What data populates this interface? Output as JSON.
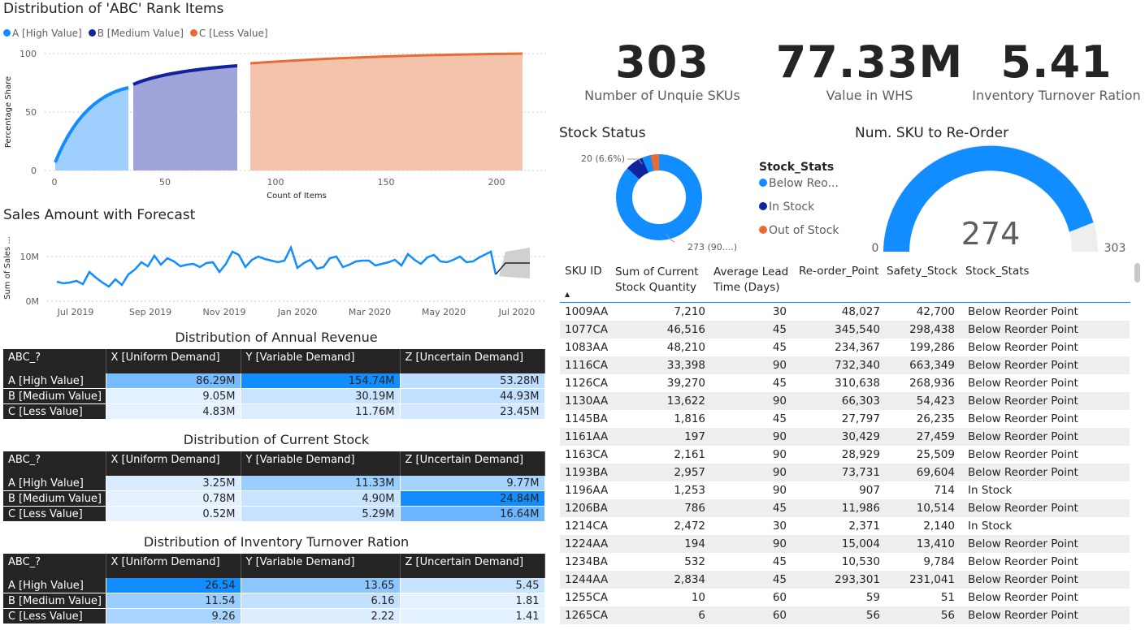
{
  "abc_chart": {
    "title": "Distribution of 'ABC' Rank Items",
    "legend": [
      {
        "label": "A [High Value]",
        "color": "#118DFF"
      },
      {
        "label": "B [Medium Value]",
        "color": "#12239E"
      },
      {
        "label": "C [Less Value]",
        "color": "#E66C37"
      }
    ],
    "ylabel": "Percentage Share",
    "xlabel": "Count of Items",
    "yticks": [
      "100",
      "50",
      "0"
    ],
    "xticks": [
      "0",
      "50",
      "100",
      "150",
      "200"
    ]
  },
  "sales_chart": {
    "title": "Sales Amount with Forecast",
    "ylabel": "Sum of Sales ...",
    "yticks": [
      "10M",
      "0M"
    ],
    "xticks": [
      "Jul 2019",
      "Sep 2019",
      "Nov 2019",
      "Jan 2020",
      "Mar 2020",
      "May 2020",
      "Jul 2020"
    ]
  },
  "kpis": [
    {
      "value": "303",
      "label": "Number of Unquie SKUs"
    },
    {
      "value": "77.33M",
      "label": "Value in WHS"
    },
    {
      "value": "5.41",
      "label": "Inventory Turnover Ration"
    }
  ],
  "stock_status": {
    "title": "Stock Status",
    "label_small": "20 (6.6%)",
    "label_large": "273 (90....)",
    "legend_title": "Stock_Stats",
    "legend": [
      {
        "label": "Below Reo...",
        "color": "#118DFF"
      },
      {
        "label": "In Stock",
        "color": "#12239E"
      },
      {
        "label": "Out of Stock",
        "color": "#E66C37"
      }
    ]
  },
  "gauge": {
    "title": "Num. SKU to Re-Order",
    "value": "274",
    "min": "0",
    "max": "303"
  },
  "matrices": [
    {
      "title": "Distribution of Annual Revenue",
      "headers": [
        "ABC_?",
        "X [Uniform Demand]",
        "Y [Variable Demand]",
        "Z [Uncertain Demand]"
      ],
      "rows": [
        {
          "label": "A [High Value]",
          "values": [
            "86.29M",
            "154.74M",
            "53.28M"
          ]
        },
        {
          "label": "B [Medium Value]",
          "values": [
            "9.05M",
            "30.19M",
            "44.93M"
          ]
        },
        {
          "label": "C [Less Value]",
          "values": [
            "4.83M",
            "11.76M",
            "23.45M"
          ]
        }
      ]
    },
    {
      "title": "Distribution of Current Stock",
      "headers": [
        "ABC_?",
        "X [Uniform Demand]",
        "Y [Variable Demand]",
        "Z [Uncertain Demand]"
      ],
      "rows": [
        {
          "label": "A [High Value]",
          "values": [
            "3.25M",
            "11.33M",
            "9.77M"
          ]
        },
        {
          "label": "B [Medium Value]",
          "values": [
            "0.78M",
            "4.90M",
            "24.84M"
          ]
        },
        {
          "label": "C [Less Value]",
          "values": [
            "0.52M",
            "5.29M",
            "16.64M"
          ]
        }
      ]
    },
    {
      "title": "Distribution of Inventory Turnover Ration",
      "headers": [
        "ABC_?",
        "X [Uniform Demand]",
        "Y [Variable Demand]",
        "Z [Uncertain Demand]"
      ],
      "rows": [
        {
          "label": "A [High Value]",
          "values": [
            "26.54",
            "13.65",
            "5.45"
          ]
        },
        {
          "label": "B [Medium Value]",
          "values": [
            "11.54",
            "6.16",
            "1.81"
          ]
        },
        {
          "label": "C [Less Value]",
          "values": [
            "9.26",
            "2.22",
            "1.41"
          ]
        }
      ]
    }
  ],
  "sku_table": {
    "headers": [
      "SKU ID",
      "Sum of Current Stock Quantity",
      "Average Lead Time (Days)",
      "Re-order_Point",
      "Safety_Stock",
      "Stock_Stats"
    ],
    "rows": [
      [
        "1009AA",
        "7,210",
        "30",
        "48,027",
        "42,700",
        "Below Reorder Point"
      ],
      [
        "1077CA",
        "46,516",
        "45",
        "345,540",
        "298,438",
        "Below Reorder Point"
      ],
      [
        "1083AA",
        "48,210",
        "45",
        "234,367",
        "199,286",
        "Below Reorder Point"
      ],
      [
        "1116CA",
        "33,398",
        "90",
        "732,340",
        "663,349",
        "Below Reorder Point"
      ],
      [
        "1126CA",
        "39,270",
        "45",
        "310,638",
        "268,936",
        "Below Reorder Point"
      ],
      [
        "1130AA",
        "13,622",
        "90",
        "66,303",
        "54,423",
        "Below Reorder Point"
      ],
      [
        "1145BA",
        "1,816",
        "45",
        "27,797",
        "26,235",
        "Below Reorder Point"
      ],
      [
        "1161AA",
        "197",
        "90",
        "30,429",
        "27,459",
        "Below Reorder Point"
      ],
      [
        "1163CA",
        "2,161",
        "90",
        "28,929",
        "25,509",
        "Below Reorder Point"
      ],
      [
        "1193BA",
        "2,957",
        "90",
        "73,731",
        "69,604",
        "Below Reorder Point"
      ],
      [
        "1196AA",
        "1,253",
        "90",
        "907",
        "714",
        "In Stock"
      ],
      [
        "1206BA",
        "786",
        "45",
        "11,986",
        "10,514",
        "Below Reorder Point"
      ],
      [
        "1214CA",
        "2,472",
        "30",
        "2,371",
        "2,140",
        "In Stock"
      ],
      [
        "1224AA",
        "194",
        "90",
        "15,004",
        "13,410",
        "Below Reorder Point"
      ],
      [
        "1234BA",
        "532",
        "45",
        "10,530",
        "9,784",
        "Below Reorder Point"
      ],
      [
        "1244AA",
        "2,834",
        "45",
        "293,301",
        "231,041",
        "Below Reorder Point"
      ],
      [
        "1255CA",
        "10",
        "60",
        "59",
        "51",
        "Below Reorder Point"
      ],
      [
        "1265CA",
        "6",
        "60",
        "56",
        "56",
        "Below Reorder Point"
      ]
    ]
  }
}
